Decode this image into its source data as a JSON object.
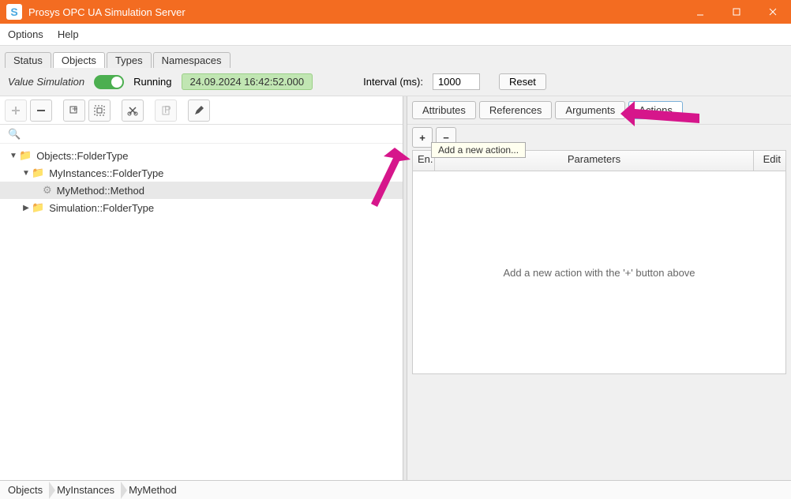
{
  "window": {
    "title": "Prosys OPC UA Simulation Server",
    "app_icon_letter": "S"
  },
  "menu": {
    "options": "Options",
    "help": "Help"
  },
  "tabs": {
    "status": "Status",
    "objects": "Objects",
    "types": "Types",
    "namespaces": "Namespaces"
  },
  "simulation": {
    "label": "Value Simulation",
    "status": "Running",
    "timestamp": "24.09.2024 16:42:52.000",
    "interval_label": "Interval (ms):",
    "interval_value": "1000",
    "reset": "Reset"
  },
  "tree": {
    "root": {
      "label": "Objects::FolderType",
      "expanded": true
    },
    "child1": {
      "label": "MyInstances::FolderType",
      "expanded": true
    },
    "method": {
      "label": "MyMethod::Method"
    },
    "child2": {
      "label": "Simulation::FolderType",
      "expanded": false
    }
  },
  "search_icon_glyph": "🔍",
  "right": {
    "tabs": {
      "attributes": "Attributes",
      "references": "References",
      "arguments": "Arguments",
      "actions": "Actions"
    },
    "tooltip": "Add a new action...",
    "cols": {
      "en": "En.",
      "param": "Parameters",
      "edit": "Edit"
    },
    "empty": "Add a new action with the '+' button above"
  },
  "breadcrumb": {
    "a": "Objects",
    "b": "MyInstances",
    "c": "MyMethod"
  }
}
